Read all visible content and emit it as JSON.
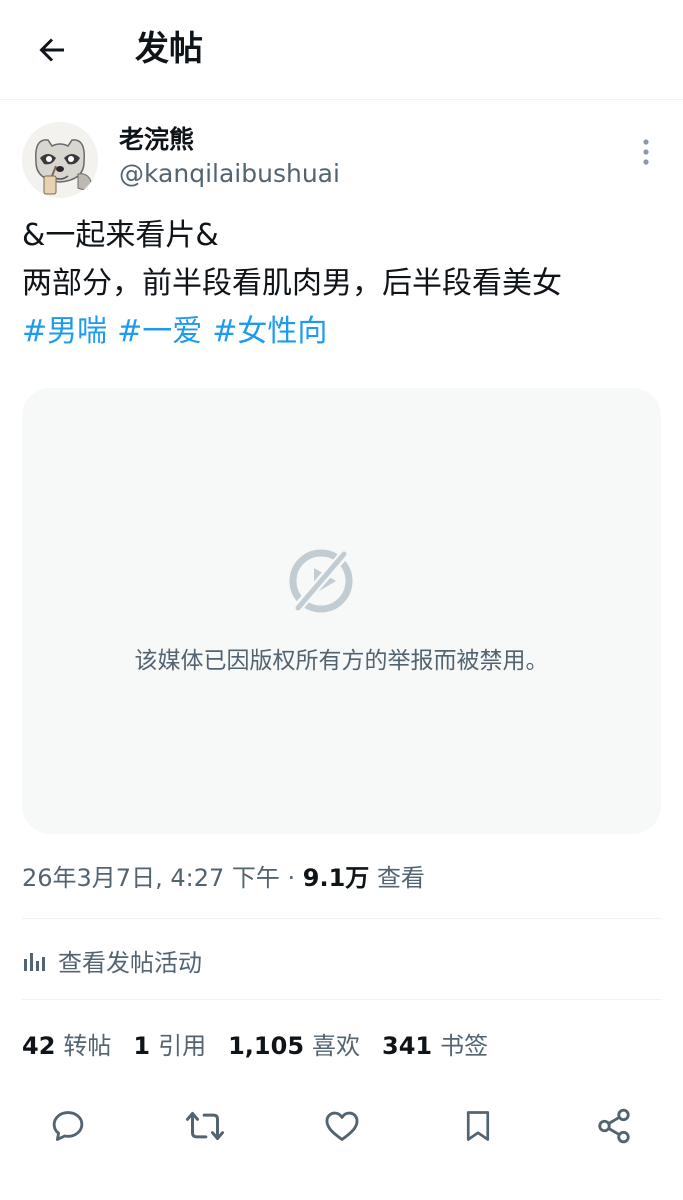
{
  "header": {
    "title": "发帖",
    "back_icon": "arrow-left-icon"
  },
  "author": {
    "display_name": "老浣熊",
    "handle": "@kanqilaibushuai",
    "avatar": "raccoon-avatar"
  },
  "tweet": {
    "lines": [
      "&一起来看片&",
      "两部分，前半段看肌肉男，后半段看美女"
    ],
    "hashtags": [
      "#男喘",
      "#一爱",
      "#女性向"
    ]
  },
  "media": {
    "message": "该媒体已因版权所有方的举报而被禁用。",
    "icon": "media-unavailable-icon"
  },
  "meta": {
    "timestamp": "26年3月7日, 4:27 下午",
    "separator": "·",
    "views_count": "9.1万",
    "views_label": "查看"
  },
  "activity": {
    "label": "查看发帖活动",
    "icon": "analytics-icon"
  },
  "stats": [
    {
      "count": "42",
      "label": "转帖"
    },
    {
      "count": "1",
      "label": "引用"
    },
    {
      "count": "1,105",
      "label": "喜欢"
    },
    {
      "count": "341",
      "label": "书签"
    }
  ],
  "actions": [
    "reply-icon",
    "repost-icon",
    "like-icon",
    "bookmark-icon",
    "share-icon"
  ],
  "colors": {
    "accent": "#1d9bf0",
    "secondary_text": "#536471",
    "primary_text": "#0f1419",
    "media_bg": "#f7f9f9",
    "icon_gray": "#c1ccd3"
  }
}
